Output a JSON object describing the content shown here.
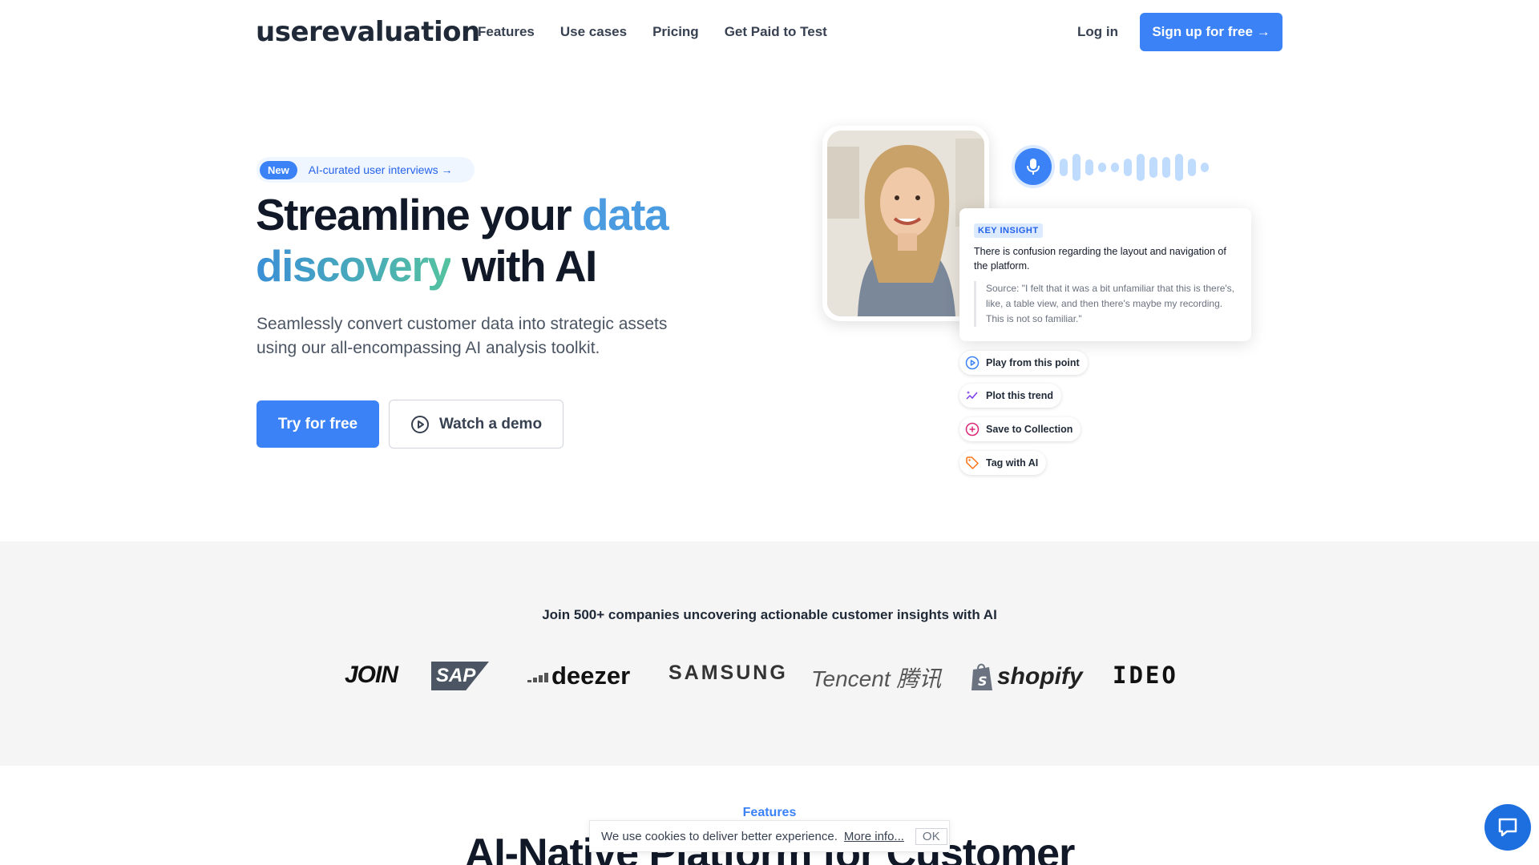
{
  "nav": {
    "logo": "userevaluation",
    "links": [
      "Features",
      "Use cases",
      "Pricing",
      "Get Paid to Test"
    ],
    "login": "Log in",
    "signup": "Sign up for free →"
  },
  "hero": {
    "pill_badge": "New",
    "pill_text": "AI-curated user interviews →",
    "headline_part1": "Streamline your ",
    "headline_accent1": "data",
    "headline_accent2": "discovery",
    "headline_part2": " with AI",
    "subtext": "Seamlessly convert customer data into strategic assets using our all-encompassing AI analysis toolkit.",
    "try_button": "Try for free",
    "demo_button": "Watch a demo"
  },
  "insight": {
    "tag": "KEY INSIGHT",
    "text": "There is confusion regarding the layout and navigation of the platform.",
    "source": "Source: \"I felt that it was a bit unfamiliar that this is there's, like, a table view, and then there's maybe my recording. This is not so familiar.\""
  },
  "actions": [
    {
      "label": "Play from this point",
      "icon": "play-circle-icon",
      "color": "#3b82f6"
    },
    {
      "label": "Plot this trend",
      "icon": "sparkle-trend-icon",
      "color": "#7c3aed"
    },
    {
      "label": "Save to Collection",
      "icon": "plus-circle-icon",
      "color": "#db2777"
    },
    {
      "label": "Tag with AI",
      "icon": "tag-icon",
      "color": "#f97316"
    }
  ],
  "logos": {
    "heading": "Join 500+ companies uncovering actionable customer insights with AI",
    "companies": [
      "JOIN",
      "SAP",
      "deezer",
      "SAMSUNG",
      "Tencent 腾讯",
      "shopify",
      "IDEO"
    ]
  },
  "features": {
    "label": "Features",
    "title": "AI-Native Platform for Customer"
  },
  "cookie": {
    "text": "We use cookies to deliver better experience.",
    "more": "More info...",
    "ok": "OK"
  },
  "colors": {
    "accent": "#3b82f6"
  }
}
